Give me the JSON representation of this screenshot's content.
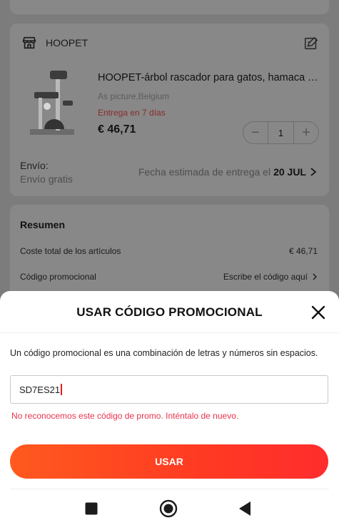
{
  "store": {
    "name": "HOOPET",
    "icon": "store-icon",
    "edit_icon": "edit-icon"
  },
  "product": {
    "title": "HOOPET-árbol rascador para gatos, hamaca p...",
    "variant": "As picture,Belgium",
    "delivery": "Entrega en 7 días",
    "price": "€ 46,71",
    "quantity": "1",
    "decrease_symbol": "−",
    "increase_symbol": "+"
  },
  "shipping": {
    "label": "Envío:",
    "cost": "Envío gratis",
    "estimate_prefix": "Fecha estimada de entrega el",
    "estimate_date": "20 JUL"
  },
  "summary": {
    "title": "Resumen",
    "items_label": "Coste total de los artículos",
    "items_value": "€ 46,71",
    "promo_label": "Código promocional",
    "promo_action": "Escribe el código aquí"
  },
  "promo_sheet": {
    "title": "USAR CÓDIGO PROMOCIONAL",
    "description": "Un código promocional es una combinación de letras y números sin espacios.",
    "input_value": "SD7ES21",
    "error": "No reconocemos este código de promo. Inténtalo de nuevo.",
    "submit_label": "USAR"
  },
  "colors": {
    "accent": "#ff3d22",
    "error": "#e8334d"
  },
  "nav": {
    "icons": [
      "recents-square-icon",
      "home-circle-icon",
      "back-triangle-icon"
    ]
  }
}
